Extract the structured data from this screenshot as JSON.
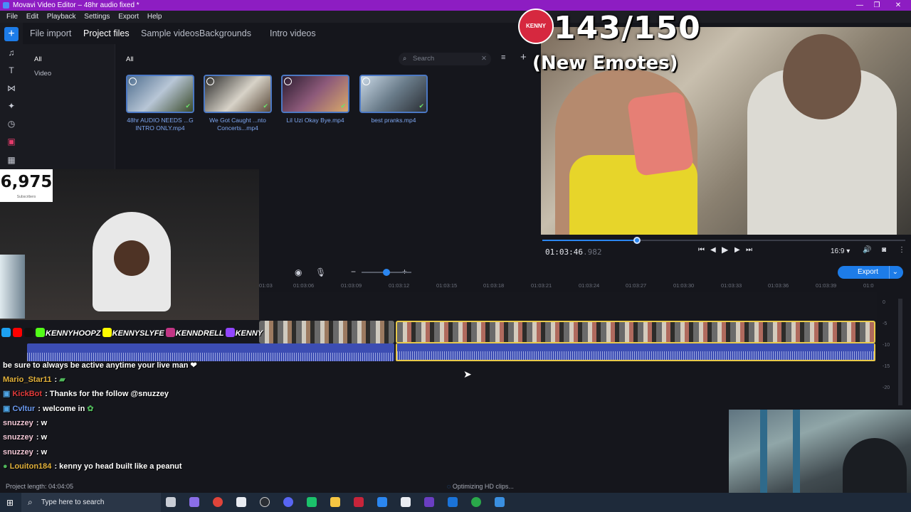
{
  "window": {
    "title": "Movavi Video Editor – 48hr audio fixed *"
  },
  "menu": [
    "File",
    "Edit",
    "Playback",
    "Settings",
    "Export",
    "Help"
  ],
  "import_tabs": [
    "File import",
    "Project files",
    "Sample videos",
    "Backgrounds",
    "Intro videos"
  ],
  "categories": {
    "heading": "All",
    "items": [
      "All",
      "Video"
    ]
  },
  "search": {
    "placeholder": "Search"
  },
  "media": [
    {
      "caption": "48hr AUDIO NEEDS ...G INTRO ONLY.mp4"
    },
    {
      "caption": "We Got Caught ...nto Concerts...mp4"
    },
    {
      "caption": "Lil Uzi Okay Bye.mp4"
    },
    {
      "caption": "best pranks.mp4"
    }
  ],
  "overlay": {
    "counter": "143/150",
    "subtitle": "(New Emotes)",
    "badge": "KENNY"
  },
  "player": {
    "timecode": "01:03:46",
    "timecode_ms": ".982",
    "aspect": "16:9 ▾",
    "progress": 0.26
  },
  "timeline": {
    "export_label": "Export",
    "ruler": [
      "01:03",
      "01:03:06",
      "01:03:09",
      "01:03:12",
      "01:03:15",
      "01:03:18",
      "01:03:21",
      "01:03:24",
      "01:03:27",
      "01:03:30",
      "01:03:33",
      "01:03:36",
      "01:03:39",
      "01:0"
    ],
    "meter": [
      "0",
      "-5",
      "-10",
      "-15",
      "-20"
    ]
  },
  "stream": {
    "subscribers": "6,975",
    "subscribers_label": "Subscribers",
    "socials": [
      "KENNYHOOPZ",
      "KENNYSLYFE",
      "KENNDRELL",
      "KENNY"
    ],
    "chat": [
      {
        "user": "",
        "text": "be sure to always be active anytime your live man ❤",
        "color": "#ffffff"
      },
      {
        "user": "Mario_Star11",
        "text": " : ",
        "color": "#e3b23c"
      },
      {
        "user": "KickBot",
        "text": " : Thanks for the follow @snuzzey",
        "color": "#e23b3b"
      },
      {
        "user": "Cvltur",
        "text": " : welcome in",
        "color": "#6c9bf2"
      },
      {
        "user": "snuzzey",
        "text": " : w",
        "color": "#f3c8d7"
      },
      {
        "user": "snuzzey",
        "text": " : w",
        "color": "#f3c8d7"
      },
      {
        "user": "snuzzey",
        "text": " : w",
        "color": "#f3c8d7"
      },
      {
        "user": "Louiton184",
        "text": " : kenny yo head built like a peanut",
        "color": "#e3b23c"
      }
    ]
  },
  "status": {
    "project_length": "Project length: 04:04:05",
    "optimizing": "Optimizing HD clips..."
  },
  "taskbar": {
    "search_placeholder": "Type here to search"
  }
}
